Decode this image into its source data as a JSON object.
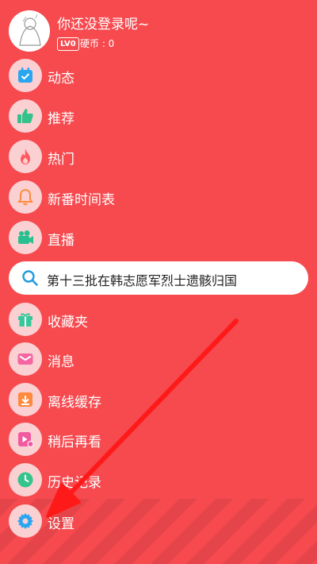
{
  "profile": {
    "username": "你还没登录呢~",
    "level": "LV0",
    "coins": "硬币 : 0"
  },
  "menu": [
    {
      "label": "动态",
      "icon": "calendar-icon",
      "color": "#2aa6f0"
    },
    {
      "label": "推荐",
      "icon": "thumbs-up-icon",
      "color": "#34c28b"
    },
    {
      "label": "热门",
      "icon": "flame-icon",
      "color": "#ff5a5f"
    },
    {
      "label": "新番时间表",
      "icon": "bell-icon",
      "color": "#ff8a3d"
    },
    {
      "label": "直播",
      "icon": "video-camera-icon",
      "color": "#27c08e"
    }
  ],
  "search": {
    "text": "第十三批在韩志愿军烈士遗骸归国"
  },
  "menu2": [
    {
      "label": "收藏夹",
      "icon": "gift-box-icon",
      "color": "#38c79a"
    },
    {
      "label": "消息",
      "icon": "envelope-icon",
      "color": "#f565a2"
    },
    {
      "label": "离线缓存",
      "icon": "download-icon",
      "color": "#ff8a3d"
    },
    {
      "label": "稍后再看",
      "icon": "play-later-icon",
      "color": "#f05aa0"
    },
    {
      "label": "历史记录",
      "icon": "clock-icon",
      "color": "#37c38d"
    },
    {
      "label": "设置",
      "icon": "gear-icon",
      "color": "#2aa6f0"
    }
  ],
  "colors": {
    "background": "#f64a4f",
    "icon_circle": "#fbd0d2",
    "arrow": "#ff1a1a"
  }
}
